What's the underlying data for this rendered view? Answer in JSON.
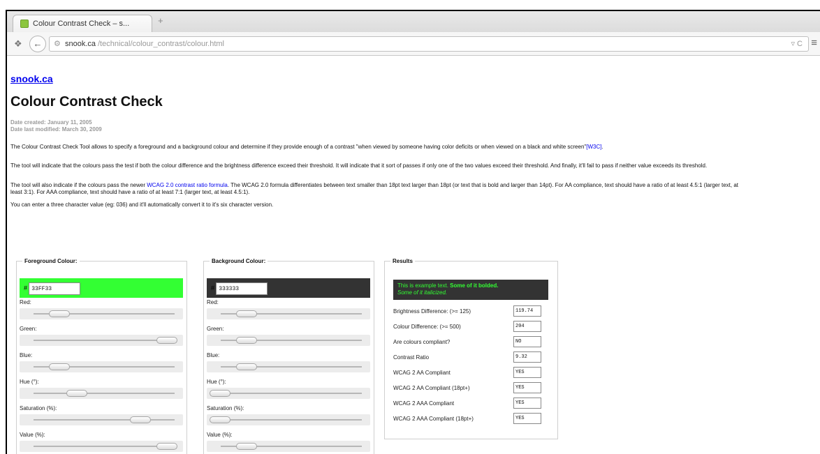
{
  "browser": {
    "tab_title": "Colour Contrast Check – s...",
    "new_tab_glyph": "+",
    "url_host": "snook.ca",
    "url_path": "/technical/colour_contrast/colour.html",
    "url_right_glyph": "▿ C",
    "icons": [
      "back-arrow-icon",
      "lock-icon",
      "reload-icon",
      "menu-icon",
      "snap-icon"
    ]
  },
  "page": {
    "site_link": "snook.ca",
    "title": "Colour Contrast Check",
    "date_created": "Date created: January 11, 2005",
    "date_modified": "Date last modified: March 30, 2009",
    "intro_1_a": "The Colour Contrast Check Tool allows to specify a foreground and a background colour and determine if they provide enough of a contrast \"when viewed by someone having color deficits or when viewed on a black and white screen\"",
    "intro_1_link": "[W3C]",
    "intro_1_b": ".",
    "intro_2": "The tool will indicate that the colours pass the test if both the colour difference and the brightness difference exceed their threshold. It will indicate that it sort of passes if only one of the two values exceed their threshold. And finally, it'll fail to pass if neither value exceeds its threshold.",
    "intro_3_a": "The tool will also indicate if the colours pass the newer ",
    "intro_3_link": "WCAG 2.0 contrast ratio formula",
    "intro_3_b": ". The WCAG 2.0 formula differentiates between text smaller than 18pt text larger than 18pt (or text that is bold and larger than 14pt). For AA compliance, text should have a ratio of at least 4.5:1 (larger text, at least 3:1). For AAA compliance, text should have a ratio of at least 7:1 (larger text, at least 4.5:1).",
    "intro_4": "You can enter a three character value (eg: 036) and it'll automatically convert it to it's six character version."
  },
  "foreground": {
    "legend": "Foreground Colour:",
    "hash": "#",
    "hex": "33FF33",
    "swatch_color": "#33ff33",
    "sliders": [
      {
        "label": "Red:",
        "level": 0.2
      },
      {
        "label": "Green:",
        "level": 1.0
      },
      {
        "label": "Blue:",
        "level": 0.2
      },
      {
        "label": "Hue (°):",
        "level": 0.33
      },
      {
        "label": "Saturation (%):",
        "level": 0.8
      },
      {
        "label": "Value (%):",
        "level": 1.0
      }
    ]
  },
  "background": {
    "legend": "Background Colour:",
    "hash": "#",
    "hex": "333333",
    "swatch_color": "#333333",
    "sliders": [
      {
        "label": "Red:",
        "level": 0.2
      },
      {
        "label": "Green:",
        "level": 0.2
      },
      {
        "label": "Blue:",
        "level": 0.2
      },
      {
        "label": "Hue (°):",
        "level": 0.0
      },
      {
        "label": "Saturation (%):",
        "level": 0.0
      },
      {
        "label": "Value (%):",
        "level": 0.2
      }
    ]
  },
  "results": {
    "legend": "Results",
    "sample_normal": "This is example text. ",
    "sample_bold": "Some of it bolded.",
    "sample_italic": "Some of it italicized.",
    "rows": [
      {
        "label": "Brightness Difference: (>= 125)",
        "value": "119.74"
      },
      {
        "label": "Colour Difference: (>= 500)",
        "value": "204"
      },
      {
        "label": "Are colours compliant?",
        "value": "NO"
      },
      {
        "label": "Contrast Ratio",
        "value": "9.32"
      },
      {
        "label": "WCAG 2 AA Compliant",
        "value": "YES"
      },
      {
        "label": "WCAG 2 AA Compliant (18pt+)",
        "value": "YES"
      },
      {
        "label": "WCAG 2 AAA Compliant",
        "value": "YES"
      },
      {
        "label": "WCAG 2 AAA Compliant (18pt+)",
        "value": "YES"
      }
    ]
  }
}
